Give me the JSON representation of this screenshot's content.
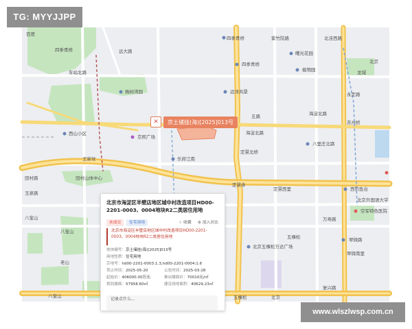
{
  "watermarks": {
    "top_left": "TG: MYYJJPP",
    "bottom_right": "www.wlszlwsp.com.cn"
  },
  "map": {
    "labels": {
      "l01": "百度",
      "l02": "四季青桥",
      "l03": "紫竹院路",
      "l04": "北洼西路",
      "l05": "四季青桥",
      "l06": "曙光花园",
      "l07": "远大路",
      "l08": "北京",
      "l09": "四季青桥",
      "l10": "植物园",
      "l11": "车站北路",
      "l12": "龙城",
      "l13": "杨树湾园",
      "l14": "远洋风景",
      "l15": "永定路",
      "l16": "西山小区",
      "l17": "五路",
      "l18": "海淀北路",
      "l19": "海淀北路",
      "l20": "苏州桥",
      "l21": "京熙广场",
      "l22": "八里庄北路",
      "l23": "定慧北桥",
      "l24": "王家坟",
      "l25": "乐府江南",
      "l26": "田村山体中心",
      "l27": "定慧寺",
      "l28": "定慧西里",
      "l29": "西钓鱼台",
      "l30": "玉泉路",
      "l31": "北京外国语大学",
      "l32": "空军特色医院",
      "l33": "万寿路",
      "l34": "八宝山",
      "l35": "北京五棵松万达广场",
      "l36": "五棵松",
      "l37": "翠微路",
      "l38": "翠微南里",
      "l39": "复兴路",
      "l40": "八宝山",
      "l41": "五棵松",
      "l42": "北京",
      "l43": "八宝山",
      "l44": "田村路",
      "l45": "老山"
    }
  },
  "marker": {
    "icon": "close-icon",
    "label": "京土储挂(海)[2025]013号"
  },
  "card": {
    "title": "北京市海淀区半壁店地区城中村改造项目HD00-2201-0003、0004地块R2二类居住用地",
    "tag_status": "未成交",
    "tag_type": "住宅用地",
    "action_collect": "收藏",
    "action_compare": "加入对比",
    "description": "北京市海淀区半壁店地区城中村改造项目HD00-2201-0003、0004地块R2二类居住用地",
    "fields": {
      "number_label": "地块编号：",
      "number_value": "京土储挂(海)[2025]013号",
      "use_label": "用地性质：",
      "use_value": "住宅用地",
      "id_label": "宗地号：",
      "id_value": "hd00-2201-0003:1.3,hd00-2201-0004:1.6",
      "start_label": "竞止时间：",
      "start_value": "2025-05-20",
      "announce_label": "公告时间：",
      "announce_value": "2025-03-28",
      "price_label": "起始价：",
      "price_value": "406000.00万元",
      "floor_label": "推出楼面价：",
      "floor_value": "70010元/㎡",
      "area_label": "规划建面：",
      "area_value": "57958.60㎡",
      "land_label": "建设用地面积：",
      "land_value": "40629.23㎡"
    },
    "more_text": "记录点什么..."
  }
}
